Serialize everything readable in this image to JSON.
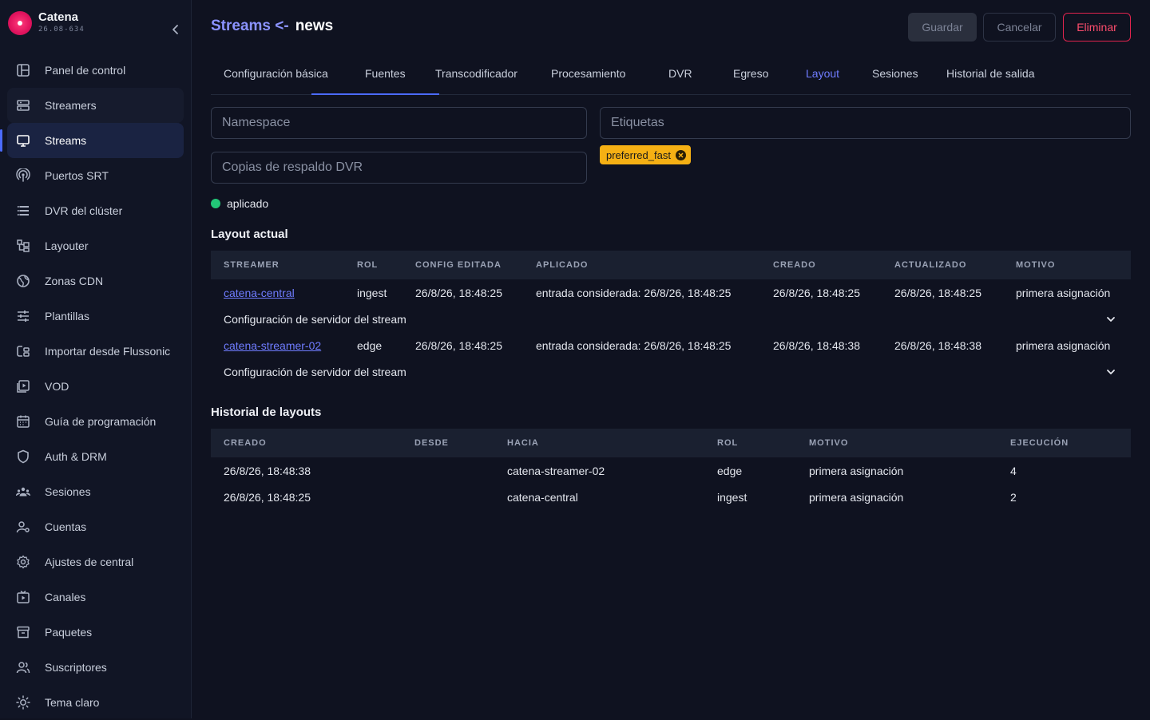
{
  "brand": {
    "name": "Catena",
    "version": "26.08-634",
    "accent": "#e0135e"
  },
  "sidebar": {
    "items": [
      {
        "label": "Panel de control",
        "icon": "dashboard-icon"
      },
      {
        "label": "Streamers",
        "icon": "server-icon"
      },
      {
        "label": "Streams",
        "icon": "monitor-icon"
      },
      {
        "label": "Puertos SRT",
        "icon": "antenna-icon"
      },
      {
        "label": "DVR del clúster",
        "icon": "storage-icon"
      },
      {
        "label": "Layouter",
        "icon": "layout-icon"
      },
      {
        "label": "Zonas CDN",
        "icon": "globe-icon"
      },
      {
        "label": "Plantillas",
        "icon": "sliders-icon"
      },
      {
        "label": "Importar desde Flussonic",
        "icon": "import-icon"
      },
      {
        "label": "VOD",
        "icon": "video-icon"
      },
      {
        "label": "Guía de programación",
        "icon": "calendar-icon"
      },
      {
        "label": "Auth & DRM",
        "icon": "shield-icon"
      },
      {
        "label": "Sesiones",
        "icon": "users-icon"
      },
      {
        "label": "Cuentas",
        "icon": "account-icon"
      },
      {
        "label": "Ajustes de central",
        "icon": "gear-icon"
      },
      {
        "label": "Canales",
        "icon": "tv-icon"
      },
      {
        "label": "Paquetes",
        "icon": "archive-icon"
      },
      {
        "label": "Suscriptores",
        "icon": "subscribers-icon"
      },
      {
        "label": "Tema claro",
        "icon": "sun-icon"
      }
    ],
    "active_index": 2
  },
  "header": {
    "title_prefix": "Streams <-",
    "title_name": "news",
    "save_label": "Guardar",
    "cancel_label": "Cancelar",
    "delete_label": "Eliminar"
  },
  "tabs": [
    "Configuración básica",
    "Fuentes",
    "Transcodificador",
    "Procesamiento",
    "DVR",
    "Egreso",
    "Layout",
    "Sesiones",
    "Historial de salida"
  ],
  "active_tab": "Layout",
  "form": {
    "namespace_placeholder": "Namespace",
    "backup_placeholder": "Copias de respaldo DVR",
    "tags_placeholder": "Etiquetas",
    "tag": "preferred_fast"
  },
  "status": {
    "label": "aplicado",
    "color": "#22c777"
  },
  "layout_actual": {
    "title": "Layout actual",
    "headers": [
      "STREAMER",
      "ROL",
      "CONFIG EDITADA",
      "APLICADO",
      "CREADO",
      "ACTUALIZADO",
      "MOTIVO"
    ],
    "rows": [
      {
        "streamer": "catena-central",
        "rol": "ingest",
        "config": "26/8/26, 18:48:25",
        "aplicado": "entrada considerada: 26/8/26, 18:48:25",
        "creado": "26/8/26, 18:48:25",
        "actualizado": "26/8/26, 18:48:25",
        "motivo": "primera asignación",
        "config_label": "Configuración de servidor del stream"
      },
      {
        "streamer": "catena-streamer-02",
        "rol": "edge",
        "config": "26/8/26, 18:48:25",
        "aplicado": "entrada considerada: 26/8/26, 18:48:25",
        "creado": "26/8/26, 18:48:38",
        "actualizado": "26/8/26, 18:48:38",
        "motivo": "primera asignación",
        "config_label": "Configuración de servidor del stream"
      }
    ]
  },
  "historial": {
    "title": "Historial de layouts",
    "headers": [
      "CREADO",
      "DESDE",
      "HACIA",
      "ROL",
      "MOTIVO",
      "EJECUCIÓN"
    ],
    "rows": [
      {
        "creado": "26/8/26, 18:48:38",
        "desde": "",
        "hacia": "catena-streamer-02",
        "rol": "edge",
        "motivo": "primera asignación",
        "ejecucion": "4"
      },
      {
        "creado": "26/8/26, 18:48:25",
        "desde": "",
        "hacia": "catena-central",
        "rol": "ingest",
        "motivo": "primera asignación",
        "ejecucion": "2"
      }
    ]
  }
}
